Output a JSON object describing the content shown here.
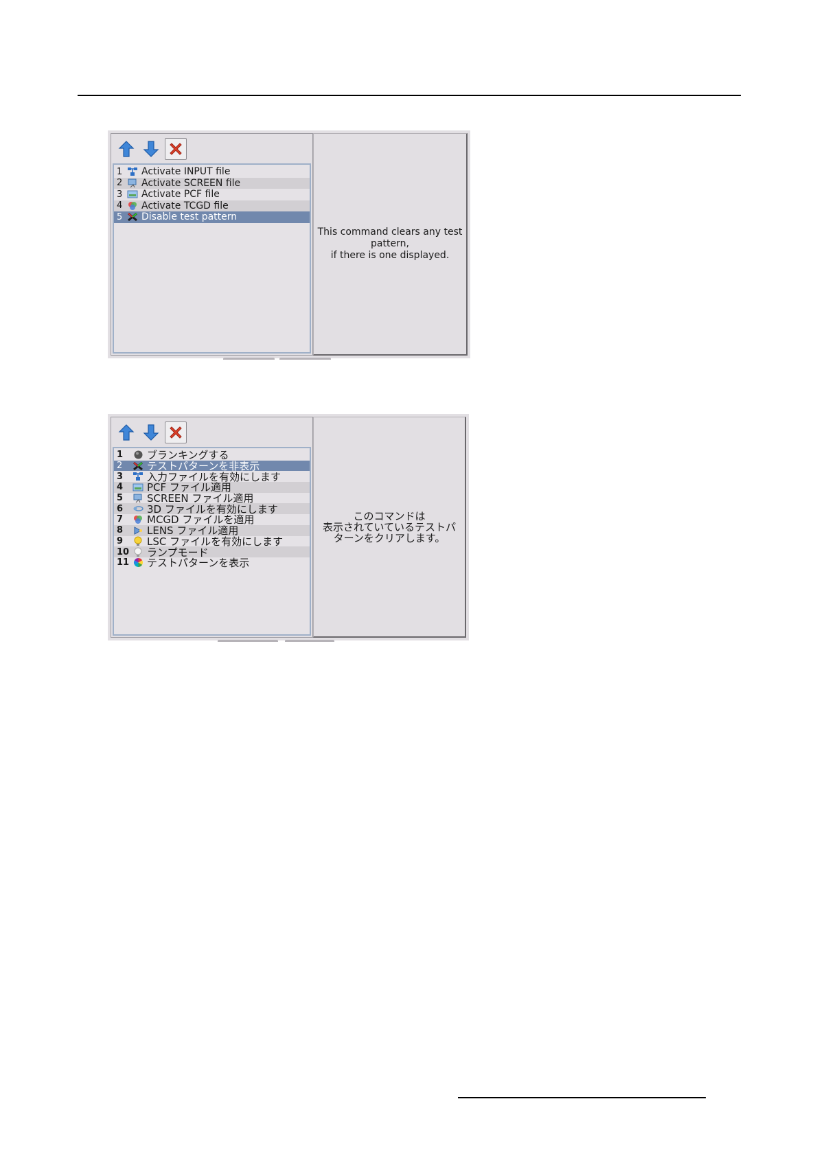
{
  "screenshot_en": {
    "toolbar": {
      "up": "arrow-up-icon",
      "down": "arrow-down-icon",
      "delete": "delete-x-icon"
    },
    "items": [
      {
        "num": "1",
        "icon": "input-icon",
        "label": "Activate INPUT file"
      },
      {
        "num": "2",
        "icon": "screen-icon",
        "label": "Activate SCREEN file"
      },
      {
        "num": "3",
        "icon": "pcf-icon",
        "label": "Activate PCF file"
      },
      {
        "num": "4",
        "icon": "tcgd-icon",
        "label": "Activate TCGD file"
      },
      {
        "num": "5",
        "icon": "test-pattern-off-icon",
        "label": "Disable test pattern"
      }
    ],
    "selected": "5",
    "description": [
      "This command clears any test",
      "pattern,",
      "if there is one displayed."
    ]
  },
  "screenshot_ja": {
    "toolbar": {
      "up": "arrow-up-icon",
      "down": "arrow-down-icon",
      "delete": "delete-x-icon"
    },
    "items": [
      {
        "num": "1",
        "icon": "blanking-icon",
        "label": "ブランキングする"
      },
      {
        "num": "2",
        "icon": "test-pattern-off-icon",
        "label": "テストパターンを非表示"
      },
      {
        "num": "3",
        "icon": "input-icon",
        "label": "入力ファイルを有効にします"
      },
      {
        "num": "4",
        "icon": "pcf-icon",
        "label": "PCF ファイル適用"
      },
      {
        "num": "5",
        "icon": "screen-icon",
        "label": "SCREEN ファイル適用"
      },
      {
        "num": "6",
        "icon": "3d-icon",
        "label": "3D ファイルを有効にします"
      },
      {
        "num": "7",
        "icon": "mcgd-icon",
        "label": "MCGD ファイルを適用"
      },
      {
        "num": "8",
        "icon": "lens-icon",
        "label": "LENS ファイル適用"
      },
      {
        "num": "9",
        "icon": "lsc-icon",
        "label": "LSC ファイルを有効にします"
      },
      {
        "num": "10",
        "icon": "lamp-icon",
        "label": "ランプモード"
      },
      {
        "num": "11",
        "icon": "test-pattern-icon",
        "label": "テストパターンを表示"
      }
    ],
    "selected": "2",
    "description": [
      "このコマンドは",
      "表示されていているテストパ",
      "ターンをクリアします。"
    ]
  }
}
